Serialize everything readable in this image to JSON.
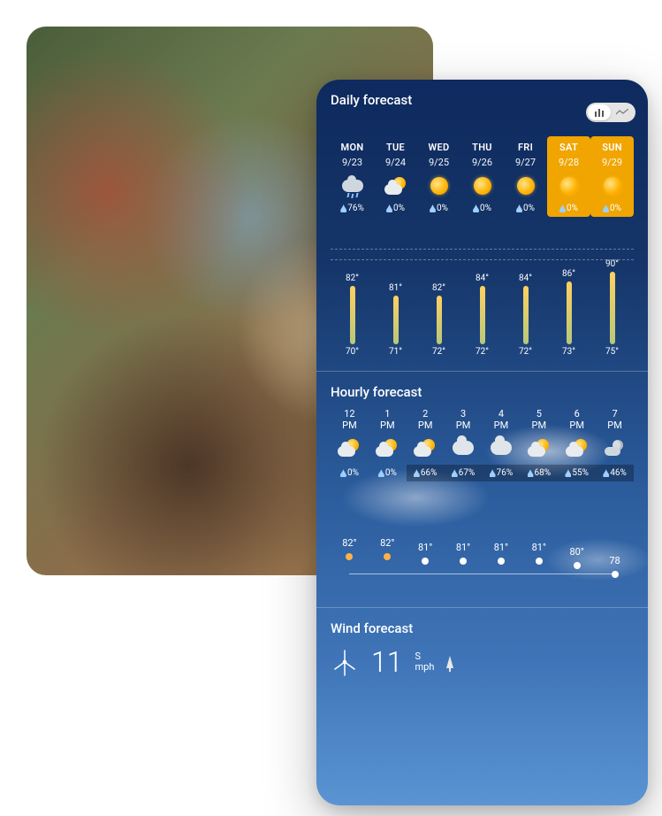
{
  "daily": {
    "title": "Daily forecast",
    "toggle": {
      "active_icon": "bars",
      "inactive_icon": "line"
    },
    "days": [
      {
        "dow": "MON",
        "date": "9/23",
        "icon": "rainy",
        "precip": "76%",
        "hi": "82°",
        "lo": "70°",
        "weekend": false
      },
      {
        "dow": "TUE",
        "date": "9/24",
        "icon": "partly",
        "precip": "0%",
        "hi": "81°",
        "lo": "71°",
        "weekend": false
      },
      {
        "dow": "WED",
        "date": "9/25",
        "icon": "sun",
        "precip": "0%",
        "hi": "82°",
        "lo": "72°",
        "weekend": false
      },
      {
        "dow": "THU",
        "date": "9/26",
        "icon": "sun",
        "precip": "0%",
        "hi": "84°",
        "lo": "72°",
        "weekend": false
      },
      {
        "dow": "FRI",
        "date": "9/27",
        "icon": "sun",
        "precip": "0%",
        "hi": "84°",
        "lo": "72°",
        "weekend": false
      },
      {
        "dow": "SAT",
        "date": "9/28",
        "icon": "sun",
        "precip": "0%",
        "hi": "86°",
        "lo": "73°",
        "weekend": true
      },
      {
        "dow": "SUN",
        "date": "9/29",
        "icon": "sun",
        "precip": "0%",
        "hi": "90°",
        "lo": "75°",
        "weekend": true
      }
    ]
  },
  "hourly": {
    "title": "Hourly forecast",
    "hours": [
      {
        "h": "12",
        "ampm": "PM",
        "icon": "partly",
        "precip": "0%",
        "shade": false,
        "temp": "82°",
        "dot": "orange"
      },
      {
        "h": "1",
        "ampm": "PM",
        "icon": "partly",
        "precip": "0%",
        "shade": false,
        "temp": "82°",
        "dot": "orange"
      },
      {
        "h": "2",
        "ampm": "PM",
        "icon": "partly",
        "precip": "66%",
        "shade": true,
        "temp": "81°",
        "dot": "white"
      },
      {
        "h": "3",
        "ampm": "PM",
        "icon": "cloudy",
        "precip": "67%",
        "shade": true,
        "temp": "81°",
        "dot": "white"
      },
      {
        "h": "4",
        "ampm": "PM",
        "icon": "cloudy",
        "precip": "76%",
        "shade": true,
        "temp": "81°",
        "dot": "white"
      },
      {
        "h": "5",
        "ampm": "PM",
        "icon": "partly",
        "precip": "68%",
        "shade": true,
        "temp": "81°",
        "dot": "white"
      },
      {
        "h": "6",
        "ampm": "PM",
        "icon": "partly",
        "precip": "55%",
        "shade": true,
        "temp": "80°",
        "dot": "white"
      },
      {
        "h": "7",
        "ampm": "PM",
        "icon": "night-partly",
        "precip": "46%",
        "shade": true,
        "temp": "78",
        "dot": "white"
      }
    ]
  },
  "wind": {
    "title": "Wind forecast",
    "speed": "11",
    "direction": "S",
    "unit": "mph"
  }
}
